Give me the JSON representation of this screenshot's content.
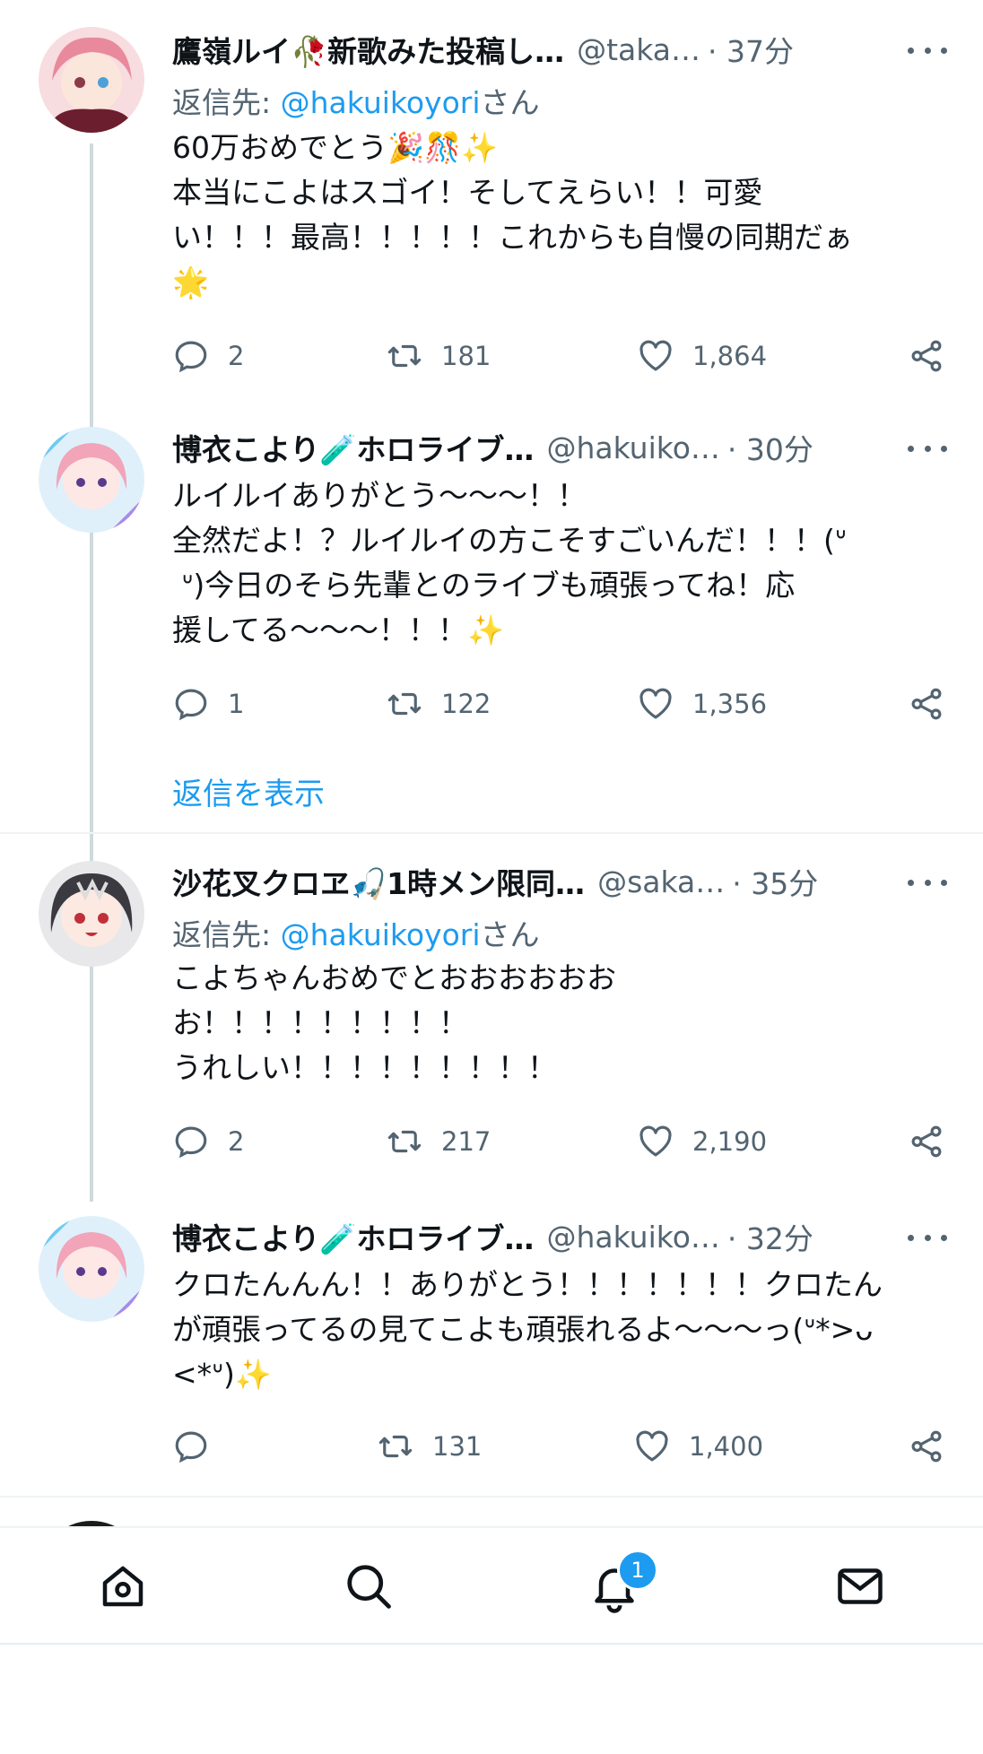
{
  "tweets": [
    {
      "name": "鷹嶺ルイ🥀新歌みた投稿し…",
      "handle": "@taka…",
      "time": "· 37分",
      "reply_prefix": "返信先: ",
      "reply_mention": "@hakuikoyori",
      "reply_suffix": "さん",
      "text": "60万おめでとう🎉🎊✨\n本当にこよはスゴイ！そしてえらい！！可愛\nい！！！最高！！！！！これからも自慢の同期だぁ\n🌟",
      "replies": "2",
      "retweets": "181",
      "likes": "1,864"
    },
    {
      "name": "博衣こより🧪ホロライブ…",
      "handle": "@hakuiko…",
      "time": "· 30分",
      "text": "ルイルイありがとう〜〜〜！！\n全然だよ！？ルイルイの方こそすごいんだ！！！(ᐡ\n ‌ᐡ)今日のそら先輩とのライブも頑張ってね！応\n援してる〜〜〜！！！✨",
      "replies": "1",
      "retweets": "122",
      "likes": "1,356"
    },
    {
      "name": "沙花叉クロヱ🎣1時メン限同…",
      "handle": "@saka…",
      "time": "· 35分",
      "reply_prefix": "返信先: ",
      "reply_mention": "@hakuikoyori",
      "reply_suffix": "さん",
      "text": "こよちゃんおめでとおおおおおお\nお！！！！！！！！！\nうれしい！！！！！！！！！",
      "replies": "2",
      "retweets": "217",
      "likes": "2,190"
    },
    {
      "name": "博衣こより🧪ホロライブ…",
      "handle": "@hakuiko…",
      "time": "· 32分",
      "text": "クロたんんん！！ありがとう！！！！！！！クロたん\nが頑張ってるの見てこよも頑張れるよ〜〜〜っ(ᐡ*>ᴗ\n<*ᐡ)✨",
      "replies": "",
      "retweets": "131",
      "likes": "1,400"
    }
  ],
  "show_replies": "返信を表示",
  "nav": {
    "icons": [
      "home-icon",
      "search-icon",
      "bell-icon",
      "mail-icon"
    ],
    "notification_count": "1"
  },
  "colors": {
    "accent": "#1d9bf0",
    "muted": "#536471",
    "text": "#0f1419",
    "line": "#cfd9de"
  }
}
